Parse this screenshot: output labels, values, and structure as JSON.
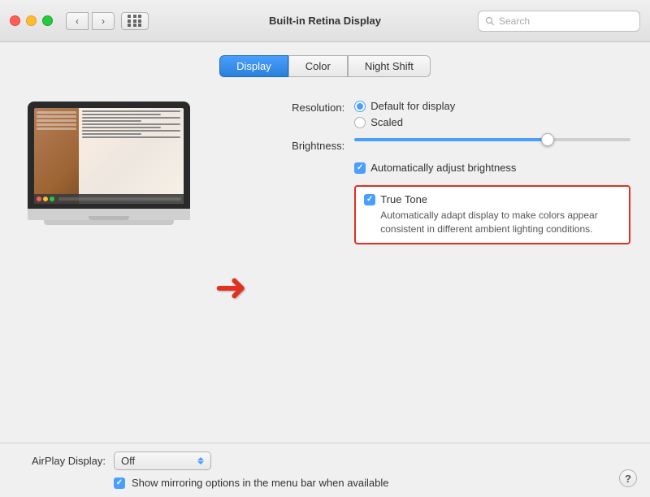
{
  "titlebar": {
    "title": "Built-in Retina Display",
    "back_btn": "‹",
    "forward_btn": "›",
    "search_placeholder": "Search"
  },
  "tabs": [
    {
      "id": "display",
      "label": "Display",
      "active": true
    },
    {
      "id": "color",
      "label": "Color",
      "active": false
    },
    {
      "id": "nightshift",
      "label": "Night Shift",
      "active": false
    }
  ],
  "resolution": {
    "label": "Resolution:",
    "options": [
      {
        "id": "default",
        "label": "Default for display",
        "checked": true
      },
      {
        "id": "scaled",
        "label": "Scaled",
        "checked": false
      }
    ]
  },
  "brightness": {
    "label": "Brightness:"
  },
  "auto_brightness": {
    "label": "Automatically adjust brightness",
    "checked": true
  },
  "true_tone": {
    "label": "True Tone",
    "checked": true,
    "description": "Automatically adapt display to make colors appear consistent in different ambient lighting conditions."
  },
  "airplay": {
    "label": "AirPlay Display:",
    "value": "Off"
  },
  "mirroring": {
    "label": "Show mirroring options in the menu bar when available",
    "checked": true
  },
  "help": {
    "label": "?"
  }
}
